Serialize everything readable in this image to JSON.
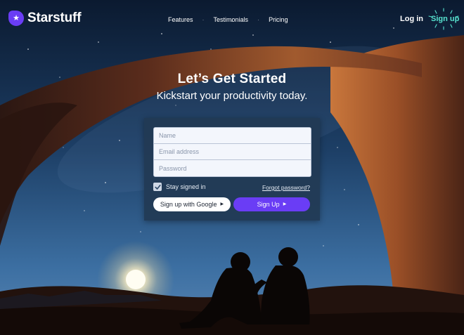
{
  "brand": {
    "name": "Starstuff",
    "logo_icon": "star-icon",
    "accent": "#6a3df5"
  },
  "nav": {
    "links": [
      "Features",
      "Testimonials",
      "Pricing"
    ],
    "login": "Log in",
    "signup": "Sign up",
    "signup_color": "#57e3cf"
  },
  "hero": {
    "title": "Let’s Get Started",
    "subtitle": "Kickstart your productivity today."
  },
  "form": {
    "name_placeholder": "Name",
    "email_placeholder": "Email address",
    "password_placeholder": "Password",
    "remember_label": "Stay signed in",
    "remember_checked": true,
    "forgot_label": "Forgot password?",
    "google_button": "Sign up with Google",
    "signup_button": "Sign Up"
  }
}
